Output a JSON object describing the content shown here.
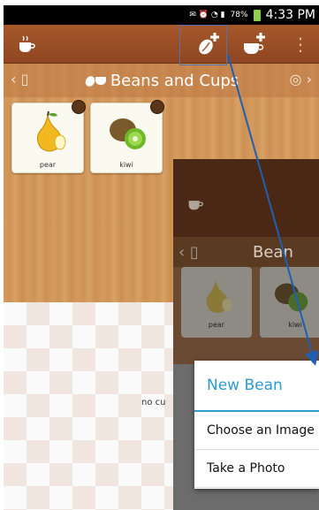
{
  "status_bar": {
    "time": "4:33 PM",
    "battery": "78%"
  },
  "action_bar": {
    "icons": [
      "cup-logo-icon",
      "add-bean-icon",
      "add-cup-icon",
      "overflow-menu-icon"
    ]
  },
  "title_bar": {
    "title": "Beans and Cups"
  },
  "cards": [
    {
      "label": "pear"
    },
    {
      "label": "kiwi"
    }
  ],
  "empty_text": "no cu",
  "inset": {
    "title": "Bean",
    "cards": [
      {
        "label": "pear"
      },
      {
        "label": "kiwi"
      }
    ]
  },
  "menu": {
    "title": "New Bean",
    "items": [
      "Choose an Image",
      "Take a Photo"
    ]
  },
  "colors": {
    "accent": "#2d9ad0",
    "action_bar": "#a6572a",
    "annotation": "#1f5fb3"
  }
}
